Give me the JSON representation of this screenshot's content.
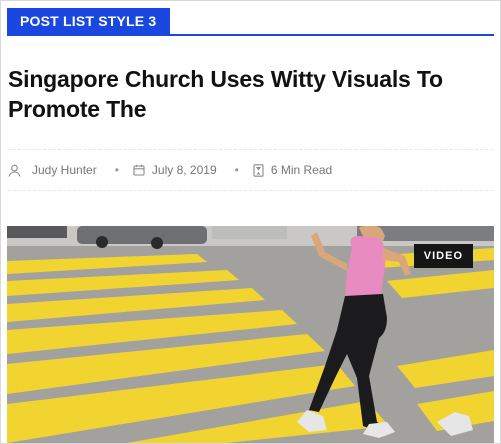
{
  "section": {
    "title": "POST LIST STYLE 3"
  },
  "post": {
    "title": "Singapore Church Uses Witty Visuals To Promote The",
    "author": "Judy Hunter",
    "date": "July 8, 2019",
    "read_time": "6 Min Read",
    "badge": "VIDEO"
  },
  "icons": [
    "user-icon",
    "calendar-icon",
    "hourglass-icon"
  ],
  "colors": {
    "accent": "#1a47e0",
    "crosswalk": "#f2d431",
    "road": "#9c9a96"
  }
}
